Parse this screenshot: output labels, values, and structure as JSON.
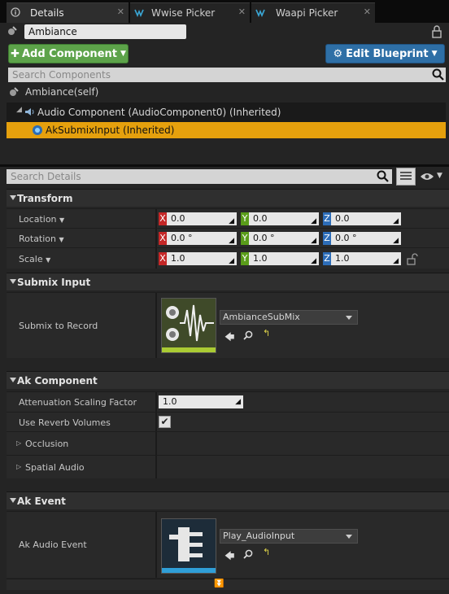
{
  "tabs": [
    {
      "label": "Details",
      "active": true
    },
    {
      "label": "Wwise Picker",
      "active": false
    },
    {
      "label": "Waapi Picker",
      "active": false
    }
  ],
  "actor_name": "Ambiance",
  "toolbar": {
    "add_component": "Add Component",
    "edit_blueprint": "Edit Blueprint"
  },
  "components": {
    "search_placeholder": "Search Components",
    "self_item": "Ambiance(self)",
    "items": [
      "Audio Component (AudioComponent0) (Inherited)",
      "AkSubmixInput (Inherited)"
    ]
  },
  "details": {
    "search_placeholder": "Search Details",
    "categories": {
      "transform": "Transform",
      "submix_input": "Submix Input",
      "ak_component": "Ak Component",
      "ak_event": "Ak Event"
    },
    "transform": {
      "location": {
        "label": "Location",
        "x": "0.0",
        "y": "0.0",
        "z": "0.0"
      },
      "rotation": {
        "label": "Rotation",
        "x": "0.0 °",
        "y": "0.0 °",
        "z": "0.0 °"
      },
      "scale": {
        "label": "Scale",
        "x": "1.0",
        "y": "1.0",
        "z": "1.0"
      }
    },
    "submix": {
      "label": "Submix to Record",
      "asset": "AmbianceSubMix"
    },
    "ak_component": {
      "attenuation_label": "Attenuation Scaling Factor",
      "attenuation_value": "1.0",
      "reverb_label": "Use Reverb Volumes",
      "reverb_checked": true,
      "occlusion_label": "Occlusion",
      "spatial_label": "Spatial Audio"
    },
    "ak_event": {
      "label": "Ak Audio Event",
      "asset": "Play_AudioInput"
    }
  },
  "axis_labels": {
    "x": "X",
    "y": "Y",
    "z": "Z"
  },
  "colors": {
    "selection": "#e5a00d",
    "add_component": "#5da34a",
    "edit_blueprint": "#2e6fa6"
  }
}
